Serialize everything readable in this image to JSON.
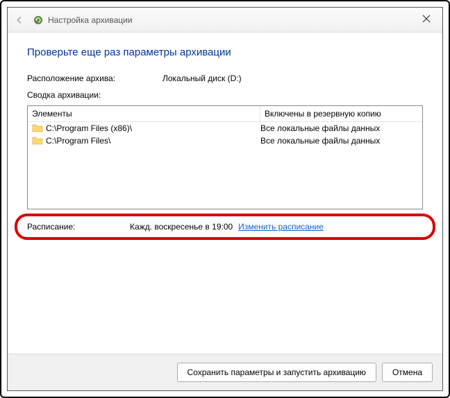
{
  "titlebar": {
    "title": "Настройка архивации"
  },
  "heading": "Проверьте еще раз параметры архивации",
  "location": {
    "label": "Расположение архива:",
    "value": "Локальный диск (D:)"
  },
  "summaryLabel": "Сводка архивации:",
  "table": {
    "cols": [
      "Элементы",
      "Включены в резервную копию"
    ],
    "rows": [
      {
        "path": "C:\\Program Files (x86)\\",
        "included": "Все локальные файлы данных"
      },
      {
        "path": "C:\\Program Files\\",
        "included": "Все локальные файлы данных"
      }
    ]
  },
  "schedule": {
    "label": "Расписание:",
    "value": "Кажд. воскресенье в 19:00",
    "link": "Изменить расписание"
  },
  "footer": {
    "save": "Сохранить параметры и запустить архивацию",
    "cancel": "Отмена"
  }
}
